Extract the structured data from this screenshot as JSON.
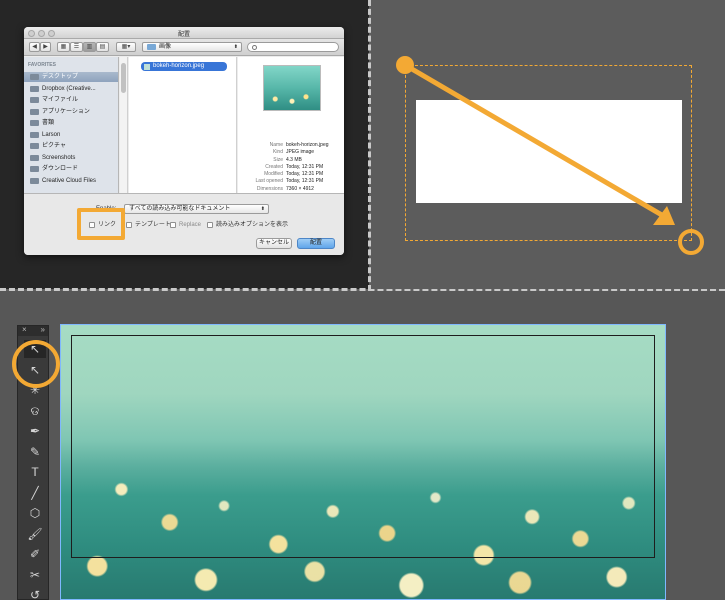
{
  "colors": {
    "accent": "#f3a934",
    "selection": "#3875d7"
  },
  "dialog": {
    "title": "配置",
    "toolbar": {
      "back_icon": "back-arrow-icon",
      "forward_icon": "forward-arrow-icon",
      "view_icons": [
        "icon-view-icon",
        "list-view-icon",
        "column-view-icon",
        "coverflow-view-icon"
      ],
      "arrange_icon": "arrange-icon",
      "location": "画像"
    },
    "sidebar": {
      "header": "FAVORITES",
      "items": [
        {
          "label": "デスクトップ",
          "icon": "desktop-icon",
          "selected": true
        },
        {
          "label": "Dropbox (Creative...",
          "icon": "folder-icon",
          "selected": false
        },
        {
          "label": "マイファイル",
          "icon": "files-icon",
          "selected": false
        },
        {
          "label": "アプリケーション",
          "icon": "applications-icon",
          "selected": false
        },
        {
          "label": "書類",
          "icon": "documents-icon",
          "selected": false
        },
        {
          "label": "Larson",
          "icon": "home-icon",
          "selected": false
        },
        {
          "label": "ピクチャ",
          "icon": "pictures-icon",
          "selected": false
        },
        {
          "label": "Screenshots",
          "icon": "folder-icon",
          "selected": false
        },
        {
          "label": "ダウンロード",
          "icon": "downloads-icon",
          "selected": false
        },
        {
          "label": "Creative Cloud Files",
          "icon": "folder-icon",
          "selected": false
        }
      ]
    },
    "file": {
      "name": "bokeh-horizon.jpeg"
    },
    "preview": {
      "rows": [
        {
          "label": "Name",
          "value": "bokeh-horizon.jpeg"
        },
        {
          "label": "Kind",
          "value": "JPEG image"
        },
        {
          "label": "Size",
          "value": "4.3 MB"
        },
        {
          "label": "Created",
          "value": "Today, 12:31 PM"
        },
        {
          "label": "Modified",
          "value": "Today, 12:31 PM"
        },
        {
          "label": "Last opened",
          "value": "Today, 12:31 PM"
        },
        {
          "label": "Dimensions",
          "value": "7360 × 4912"
        }
      ]
    },
    "enable_label": "Enable:",
    "format_select": "すべての読み込み可能なドキュメント",
    "options": {
      "link": "リンク",
      "template": "テンプレート",
      "replace": "Replace",
      "show_import_options": "読み込みオプションを表示"
    },
    "cancel_label": "キャンセル",
    "place_label": "配置"
  },
  "tools_panel": {
    "close_icon": "close-icon",
    "collapse_icon": "double-chevron-icon",
    "tools": [
      {
        "name": "selection-tool-icon",
        "glyph": "↖",
        "selected": true
      },
      {
        "name": "direct-selection-tool-icon",
        "glyph": "↖",
        "selected": false
      },
      {
        "name": "magic-wand-tool-icon",
        "glyph": "✳",
        "selected": false
      },
      {
        "name": "lasso-tool-icon",
        "glyph": "ଡ",
        "selected": false
      },
      {
        "name": "pen-tool-icon",
        "glyph": "✒",
        "selected": false
      },
      {
        "name": "curvature-tool-icon",
        "glyph": "✎",
        "selected": false
      },
      {
        "name": "type-tool-icon",
        "glyph": "T",
        "selected": false
      },
      {
        "name": "line-tool-icon",
        "glyph": "╱",
        "selected": false
      },
      {
        "name": "shape-tool-icon",
        "glyph": "⬡",
        "selected": false
      },
      {
        "name": "paintbrush-tool-icon",
        "glyph": "🖌",
        "selected": false
      },
      {
        "name": "blob-brush-tool-icon",
        "glyph": "✐",
        "selected": false
      },
      {
        "name": "scissors-tool-icon",
        "glyph": "✂",
        "selected": false
      },
      {
        "name": "rotate-tool-icon",
        "glyph": "↺",
        "selected": false
      }
    ]
  }
}
